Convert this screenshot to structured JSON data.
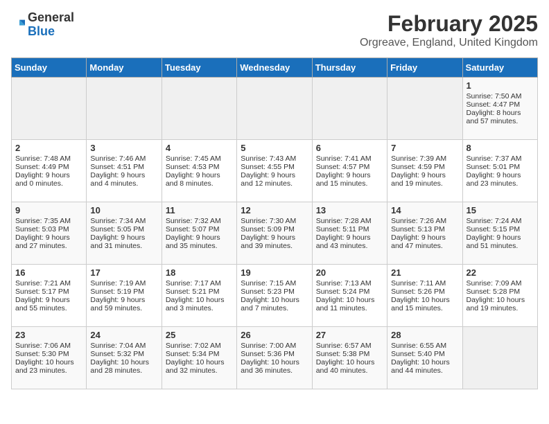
{
  "header": {
    "logo_line1": "General",
    "logo_line2": "Blue",
    "title": "February 2025",
    "subtitle": "Orgreave, England, United Kingdom"
  },
  "weekdays": [
    "Sunday",
    "Monday",
    "Tuesday",
    "Wednesday",
    "Thursday",
    "Friday",
    "Saturday"
  ],
  "weeks": [
    [
      {
        "day": "",
        "text": ""
      },
      {
        "day": "",
        "text": ""
      },
      {
        "day": "",
        "text": ""
      },
      {
        "day": "",
        "text": ""
      },
      {
        "day": "",
        "text": ""
      },
      {
        "day": "",
        "text": ""
      },
      {
        "day": "1",
        "text": "Sunrise: 7:50 AM\nSunset: 4:47 PM\nDaylight: 8 hours and 57 minutes."
      }
    ],
    [
      {
        "day": "2",
        "text": "Sunrise: 7:48 AM\nSunset: 4:49 PM\nDaylight: 9 hours and 0 minutes."
      },
      {
        "day": "3",
        "text": "Sunrise: 7:46 AM\nSunset: 4:51 PM\nDaylight: 9 hours and 4 minutes."
      },
      {
        "day": "4",
        "text": "Sunrise: 7:45 AM\nSunset: 4:53 PM\nDaylight: 9 hours and 8 minutes."
      },
      {
        "day": "5",
        "text": "Sunrise: 7:43 AM\nSunset: 4:55 PM\nDaylight: 9 hours and 12 minutes."
      },
      {
        "day": "6",
        "text": "Sunrise: 7:41 AM\nSunset: 4:57 PM\nDaylight: 9 hours and 15 minutes."
      },
      {
        "day": "7",
        "text": "Sunrise: 7:39 AM\nSunset: 4:59 PM\nDaylight: 9 hours and 19 minutes."
      },
      {
        "day": "8",
        "text": "Sunrise: 7:37 AM\nSunset: 5:01 PM\nDaylight: 9 hours and 23 minutes."
      }
    ],
    [
      {
        "day": "9",
        "text": "Sunrise: 7:35 AM\nSunset: 5:03 PM\nDaylight: 9 hours and 27 minutes."
      },
      {
        "day": "10",
        "text": "Sunrise: 7:34 AM\nSunset: 5:05 PM\nDaylight: 9 hours and 31 minutes."
      },
      {
        "day": "11",
        "text": "Sunrise: 7:32 AM\nSunset: 5:07 PM\nDaylight: 9 hours and 35 minutes."
      },
      {
        "day": "12",
        "text": "Sunrise: 7:30 AM\nSunset: 5:09 PM\nDaylight: 9 hours and 39 minutes."
      },
      {
        "day": "13",
        "text": "Sunrise: 7:28 AM\nSunset: 5:11 PM\nDaylight: 9 hours and 43 minutes."
      },
      {
        "day": "14",
        "text": "Sunrise: 7:26 AM\nSunset: 5:13 PM\nDaylight: 9 hours and 47 minutes."
      },
      {
        "day": "15",
        "text": "Sunrise: 7:24 AM\nSunset: 5:15 PM\nDaylight: 9 hours and 51 minutes."
      }
    ],
    [
      {
        "day": "16",
        "text": "Sunrise: 7:21 AM\nSunset: 5:17 PM\nDaylight: 9 hours and 55 minutes."
      },
      {
        "day": "17",
        "text": "Sunrise: 7:19 AM\nSunset: 5:19 PM\nDaylight: 9 hours and 59 minutes."
      },
      {
        "day": "18",
        "text": "Sunrise: 7:17 AM\nSunset: 5:21 PM\nDaylight: 10 hours and 3 minutes."
      },
      {
        "day": "19",
        "text": "Sunrise: 7:15 AM\nSunset: 5:23 PM\nDaylight: 10 hours and 7 minutes."
      },
      {
        "day": "20",
        "text": "Sunrise: 7:13 AM\nSunset: 5:24 PM\nDaylight: 10 hours and 11 minutes."
      },
      {
        "day": "21",
        "text": "Sunrise: 7:11 AM\nSunset: 5:26 PM\nDaylight: 10 hours and 15 minutes."
      },
      {
        "day": "22",
        "text": "Sunrise: 7:09 AM\nSunset: 5:28 PM\nDaylight: 10 hours and 19 minutes."
      }
    ],
    [
      {
        "day": "23",
        "text": "Sunrise: 7:06 AM\nSunset: 5:30 PM\nDaylight: 10 hours and 23 minutes."
      },
      {
        "day": "24",
        "text": "Sunrise: 7:04 AM\nSunset: 5:32 PM\nDaylight: 10 hours and 28 minutes."
      },
      {
        "day": "25",
        "text": "Sunrise: 7:02 AM\nSunset: 5:34 PM\nDaylight: 10 hours and 32 minutes."
      },
      {
        "day": "26",
        "text": "Sunrise: 7:00 AM\nSunset: 5:36 PM\nDaylight: 10 hours and 36 minutes."
      },
      {
        "day": "27",
        "text": "Sunrise: 6:57 AM\nSunset: 5:38 PM\nDaylight: 10 hours and 40 minutes."
      },
      {
        "day": "28",
        "text": "Sunrise: 6:55 AM\nSunset: 5:40 PM\nDaylight: 10 hours and 44 minutes."
      },
      {
        "day": "",
        "text": ""
      }
    ]
  ]
}
